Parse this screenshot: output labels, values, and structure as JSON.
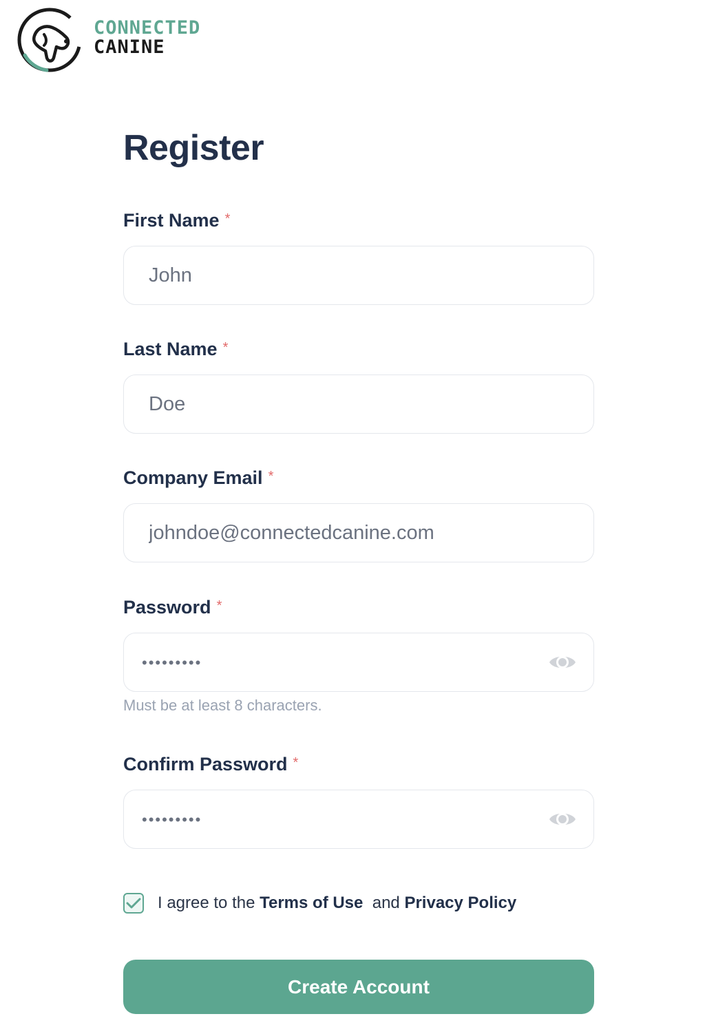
{
  "brand": {
    "line1": "CONNECTED",
    "line2": "CANINE",
    "primary_color": "#5fa792",
    "dark_color": "#1b1b1b"
  },
  "form": {
    "title": "Register",
    "required_marker": "*",
    "fields": {
      "first_name": {
        "label": "First Name",
        "placeholder": "John"
      },
      "last_name": {
        "label": "Last Name",
        "placeholder": "Doe"
      },
      "company_email": {
        "label": "Company Email",
        "placeholder": "johndoe@connectedcanine.com"
      },
      "password": {
        "label": "Password",
        "masked_value": "•••••••••",
        "hint": "Must be at least 8 characters.",
        "toggle_icon": "eye-icon"
      },
      "confirm_password": {
        "label": "Confirm Password",
        "masked_value": "•••••••••",
        "toggle_icon": "eye-icon"
      }
    },
    "agreement": {
      "checked": true,
      "prefix": "I agree to the",
      "terms_link": "Terms of Use",
      "conjunction": "and",
      "privacy_link": "Privacy Policy"
    },
    "submit_label": "Create Account",
    "button_color": "#5ca690",
    "error_color": "#e26a6a"
  }
}
